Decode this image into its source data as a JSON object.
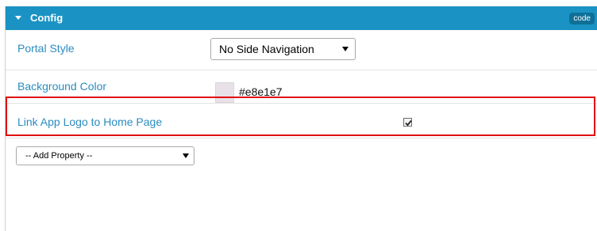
{
  "panel": {
    "title": "Config",
    "code_label": "code"
  },
  "rows": {
    "portal_style": {
      "label": "Portal Style",
      "value": "No Side Navigation"
    },
    "background_color": {
      "label": "Background Color",
      "value": "#e8e1e7",
      "swatch_color": "#e8e1e7"
    },
    "link_logo": {
      "label": "Link App Logo to Home Page",
      "checked": true
    }
  },
  "add_property": {
    "value": "-- Add Property --"
  },
  "colors": {
    "header": "#1a93c4",
    "label": "#2b8cc0",
    "highlight": "#e10f0f"
  }
}
